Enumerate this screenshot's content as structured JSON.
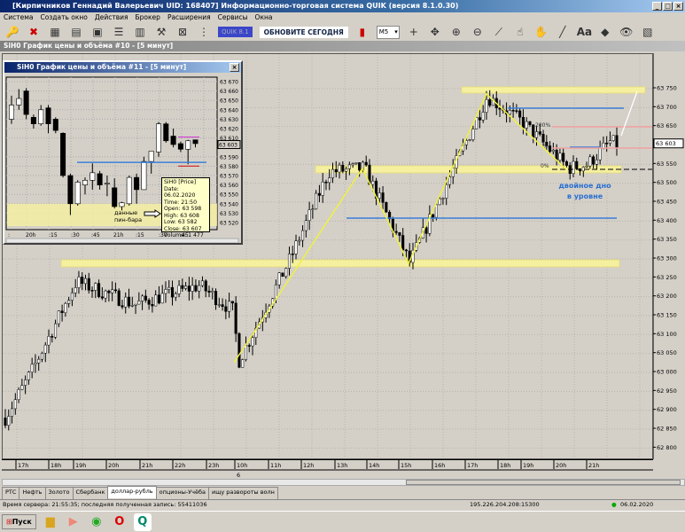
{
  "window": {
    "title": "[Кирпичников Геннадий Валерьевич UID: 168407] Информационно-торговая система QUIK (версия 8.1.0.30)",
    "min": "_",
    "max": "□",
    "close": "×"
  },
  "menu": [
    "Система",
    "Создать окно",
    "Действия",
    "Брокер",
    "Расширения",
    "Сервисы",
    "Окна"
  ],
  "toolbar": {
    "quik_label": "QUIK 8.1",
    "update_label": "ОБНОВИТЕ СЕГОДНЯ",
    "interval": "M5",
    "text_tool": "Aa"
  },
  "chart10": {
    "title": "SiH0 График цены и объёма #10 - [5 минут]",
    "price_ticks": [
      63750,
      63700,
      63650,
      63550,
      63500,
      63450,
      63400,
      63350,
      63300,
      63250,
      63200,
      63150,
      63100,
      63050,
      63000,
      62950,
      62900,
      62850,
      62800
    ],
    "current_price": "63 603",
    "time_labels": [
      "17h",
      "18h",
      "19h",
      "20h",
      "21h",
      "22h",
      "23h",
      "10h",
      "11h",
      "12h",
      "13h",
      "14h",
      "15h",
      "16h",
      "17h",
      "18h",
      "19h",
      "20h",
      "21h"
    ],
    "day_label": "6",
    "fib_labels": [
      "200%",
      "%",
      "0%"
    ],
    "annotation": [
      "двойное дно",
      "в уровне"
    ],
    "path": [
      [
        0,
        62880
      ],
      [
        0.04,
        63000
      ],
      [
        0.11,
        63240
      ],
      [
        0.2,
        63180
      ],
      [
        0.3,
        63230
      ],
      [
        0.355,
        63160
      ],
      [
        0.358,
        63020
      ],
      [
        0.44,
        63300
      ],
      [
        0.5,
        63530
      ],
      [
        0.555,
        63540
      ],
      [
        0.625,
        63290
      ],
      [
        0.745,
        63730
      ],
      [
        0.8,
        63660
      ],
      [
        0.87,
        63540
      ],
      [
        0.9,
        63550
      ],
      [
        0.935,
        63610
      ],
      [
        0.945,
        63603
      ]
    ]
  },
  "chart11": {
    "title": "SiH0 График цены и объёма #11 - [5 минут]",
    "price_ticks": [
      63670,
      63660,
      63650,
      63640,
      63630,
      63620,
      63610,
      63590,
      63580,
      63570,
      63560,
      63550,
      63540,
      63530,
      63520
    ],
    "current_price": "63 603",
    "time_labels": [
      ":",
      "20h",
      ":15",
      ":30",
      ":45",
      "21h",
      ":15",
      ":30",
      ":45"
    ],
    "candles": [
      [
        63630,
        63655,
        63625,
        63645
      ],
      [
        63645,
        63662,
        63640,
        63652
      ],
      [
        63660,
        63663,
        63630,
        63635
      ],
      [
        63632,
        63635,
        63620,
        63625
      ],
      [
        63625,
        63645,
        63623,
        63640
      ],
      [
        63642,
        63645,
        63615,
        63625
      ],
      [
        63630,
        63632,
        63615,
        63618
      ],
      [
        63615,
        63616,
        63568,
        63570
      ],
      [
        63570,
        63572,
        63528,
        63540
      ],
      [
        63540,
        63565,
        63538,
        63563
      ],
      [
        63560,
        63568,
        63550,
        63565
      ],
      [
        63565,
        63583,
        63555,
        63573
      ],
      [
        63572,
        63575,
        63555,
        63560
      ],
      [
        63562,
        63570,
        63548,
        63562
      ],
      [
        63557,
        63567,
        63535,
        63537
      ],
      [
        63537,
        63542,
        63533,
        63541
      ],
      [
        63540,
        63570,
        63538,
        63568
      ],
      [
        63568,
        63572,
        63540,
        63555
      ],
      [
        63555,
        63590,
        63555,
        63585
      ],
      [
        63585,
        63596,
        63572,
        63596
      ],
      [
        63595,
        63627,
        63590,
        63625
      ],
      [
        63625,
        63627,
        63605,
        63607
      ],
      [
        63612,
        63620,
        63600,
        63603
      ],
      [
        63604,
        63606,
        63595,
        63598
      ],
      [
        63598,
        63608,
        63582,
        63607
      ],
      [
        63608,
        63608,
        63600,
        63604
      ]
    ],
    "pin_label": [
      "данные",
      "пин-бара"
    ],
    "tooltip": [
      "SiH0 [Price]",
      "Date: 06.02.2020",
      "Time: 21:50",
      "Open:  63 598",
      "High:  63 608",
      "Low:   63 582",
      "Close: 63 607",
      "Volume: 1 477"
    ]
  },
  "tabs": [
    "РТС",
    "Нефть",
    "Золото",
    "Сбербанк",
    "доллар-рубль",
    "опционы-Учёба",
    "ищу развороты волн"
  ],
  "active_tab": 4,
  "status": {
    "left": "Время сервера: 21:55:35; последняя полученная запись: 55411036",
    "server": "195.226.204.208:15300",
    "date": "06.02.2020"
  },
  "taskbar": {
    "start": "Пуск"
  },
  "colors": {
    "zone": "#f5f0a0",
    "blue": "#3a7fd8",
    "pink": "#f0a0a0",
    "yellow_line": "#f0f040",
    "annotation": "#2a6fd0"
  }
}
